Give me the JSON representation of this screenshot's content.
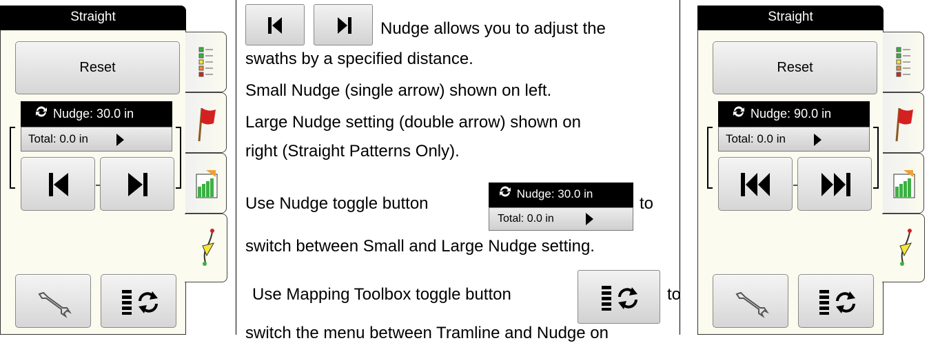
{
  "left_panel": {
    "title": "Straight",
    "reset_label": "Reset",
    "nudge_label": "Nudge: 30.0 in",
    "total_label": "Total: 0.0 in",
    "left_button": "single-left-nudge-icon",
    "right_button": "single-right-nudge-icon"
  },
  "right_panel": {
    "title": "Straight",
    "reset_label": "Reset",
    "nudge_label": "Nudge: 90.0 in",
    "total_label": "Total: 0.0 in",
    "left_button": "double-left-nudge-icon",
    "right_button": "double-right-nudge-icon"
  },
  "tabs": [
    "list-icon",
    "flag-icon",
    "field-chart-icon",
    "guidance-icon"
  ],
  "toolbar": [
    "wrench-icon",
    "mapping-toolbox-toggle-icon"
  ],
  "instructions": {
    "line1": "Nudge allows you to adjust the",
    "line2": "swaths by a specified distance.",
    "line3": "Small Nudge (single arrow) shown on left.",
    "line4": "Large Nudge setting (double arrow) shown on",
    "line5": "right (Straight Patterns Only).",
    "line6_prefix": "Use Nudge toggle button",
    "line6_suffix": "to",
    "line7": "switch between Small and Large Nudge setting.",
    "line8_prefix": "Use Mapping Toolbox toggle button",
    "line8_suffix": "to",
    "line9": "switch the menu between Tramline and Nudge on",
    "inline_nudge_label": "Nudge: 30.0 in",
    "inline_total_label": "Total: 0.0 in"
  },
  "colors": {
    "panel_bg": "#fbfbef",
    "title_bg": "#000000",
    "flag_red": "#d42020",
    "field_green": "#3cb043"
  }
}
